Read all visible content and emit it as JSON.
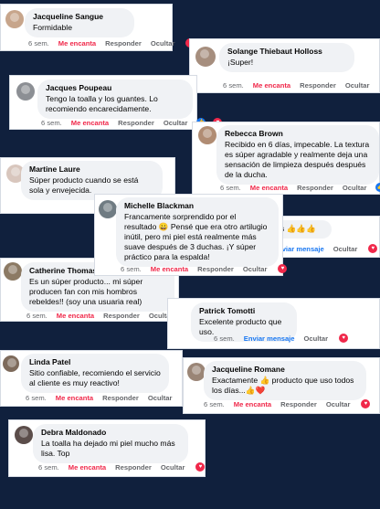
{
  "actions": {
    "love": "Me encanta",
    "reply": "Responder",
    "hide": "Ocultar",
    "send": "Enviar mensaje"
  },
  "colors": {
    "background": "#10203d",
    "love": "#f0284a",
    "like": "#1877f2",
    "bubble": "#f0f2f5"
  },
  "comments": [
    {
      "name": "Jacqueline Sangue",
      "text": "Formidable",
      "time": "6 sem."
    },
    {
      "name": "Solange Thiebaut Holloss",
      "text": "¡Super!",
      "time": "6 sem."
    },
    {
      "name": "Jacques Poupeau",
      "text": "Tengo la toalla y los guantes. Lo recomiendo encarecidamente.",
      "time": "6 sem."
    },
    {
      "name": "Rebecca Brown",
      "text": "Recibido en 6 días, impecable. La textura es súper agradable y realmente deja una sensación de limpieza después después de la ducha.",
      "time": "6 sem."
    },
    {
      "name": "Martine Laure",
      "text": "Súper producto cuando se está sola y envejecida.",
      "time": "6 sem."
    },
    {
      "name": "Michelle Blackman",
      "text": "Francamente sorprendido por el resultado 😀 Pensé que era otro artilugio inútil, pero mi piel está realmente más suave después de 3 duchas. ¡Y súper práctico para la espalda!",
      "time": "6 sem."
    },
    {
      "name": "",
      "text": "Courts 👍👍👍",
      "time": ""
    },
    {
      "name": "Catherine Thomas",
      "text": "Es un súper producto... mi súper producen fan con mis hombros rebeldes!! (soy una usuaria real)",
      "time": "6 sem."
    },
    {
      "name": "Patrick Tomotti",
      "text": "Excelente producto que uso.",
      "time": "6 sem."
    },
    {
      "name": "Linda Patel",
      "text": "Sitio confiable, recomiendo el servicio al cliente es muy reactivo!",
      "time": "6 sem."
    },
    {
      "name": "Jacqueline Romane",
      "text": "Exactamente 👍 producto que uso todos los días...👍❤️",
      "time": "6 sem."
    },
    {
      "name": "Debra Maldonado",
      "text": "La toalla ha dejado mi piel mucho más lisa. Top",
      "time": "6 sem."
    }
  ]
}
